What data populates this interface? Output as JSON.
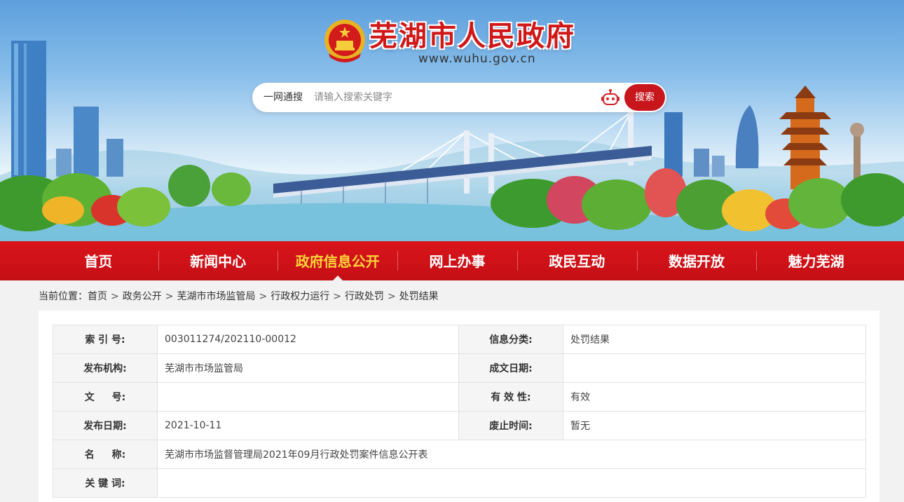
{
  "site": {
    "title": "芜湖市人民政府",
    "url": "www.wuhu.gov.cn"
  },
  "search": {
    "scope": "一网通搜",
    "placeholder": "请输入搜索关键字",
    "button": "搜索"
  },
  "nav": {
    "items": [
      "首页",
      "新闻中心",
      "政府信息公开",
      "网上办事",
      "政民互动",
      "数据开放",
      "魅力芜湖"
    ],
    "active_index": 2
  },
  "breadcrumb": {
    "prefix": "当前位置：",
    "items": [
      "首页",
      "政务公开",
      "芜湖市市场监管局",
      "行政权力运行",
      "行政处罚",
      "处罚结果"
    ],
    "separator": ">"
  },
  "info": {
    "index_label": "索 引 号:",
    "index_value": "003011274/202110-00012",
    "category_label": "信息分类:",
    "category_value": "处罚结果",
    "publisher_label": "发布机构:",
    "publisher_value": "芜湖市市场监管局",
    "created_label": "成文日期:",
    "created_value": "",
    "docno_label": "文 号:",
    "docno_value": "",
    "validity_label": "有 效 性:",
    "validity_value": "有效",
    "pubdate_label": "发布日期:",
    "pubdate_value": "2021-10-11",
    "expire_label": "废止时间:",
    "expire_value": "暂无",
    "name_label": "名 称:",
    "name_value": "芜湖市市场监督管理局2021年09月行政处罚案件信息公开表",
    "keywords_label": "关 键 词:",
    "keywords_value": ""
  },
  "colors": {
    "brand_red": "#c8161d",
    "nav_active": "#ffd43a"
  }
}
